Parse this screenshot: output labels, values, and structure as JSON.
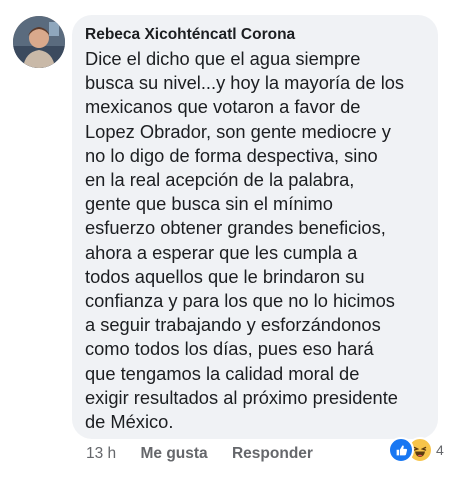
{
  "comment": {
    "author": "Rebeca Xicohténcatl Corona",
    "lines": [
      "Dice el dicho que el agua siempre",
      "busca su nivel...y hoy la mayoría de los",
      "mexicanos que votaron a favor de",
      "Lopez Obrador, son gente mediocre y",
      "no lo digo de forma despectiva, sino",
      "en la real acepción de la palabra,",
      "gente que busca sin el mínimo",
      "esfuerzo obtener grandes beneficios,",
      "ahora a esperar que les cumpla a",
      "todos aquellos que le brindaron su",
      "confianza y para los que no lo hicimos",
      "a seguir trabajando y esforzándonos",
      "como todos los días, pues eso hará",
      "que tengamos la calidad moral de",
      "exigir resultados al próximo presidente",
      "de México."
    ]
  },
  "actions": {
    "time": "13 h",
    "like_label": "Me gusta",
    "reply_label": "Responder"
  },
  "reactions": {
    "icons": [
      "like-icon",
      "haha-icon"
    ],
    "count": "4",
    "like_color": "#1877f2",
    "haha_color": "#f7c44a"
  },
  "colors": {
    "bubble": "#f0f2f5",
    "text": "#1c1e21",
    "secondary": "#65676b"
  }
}
